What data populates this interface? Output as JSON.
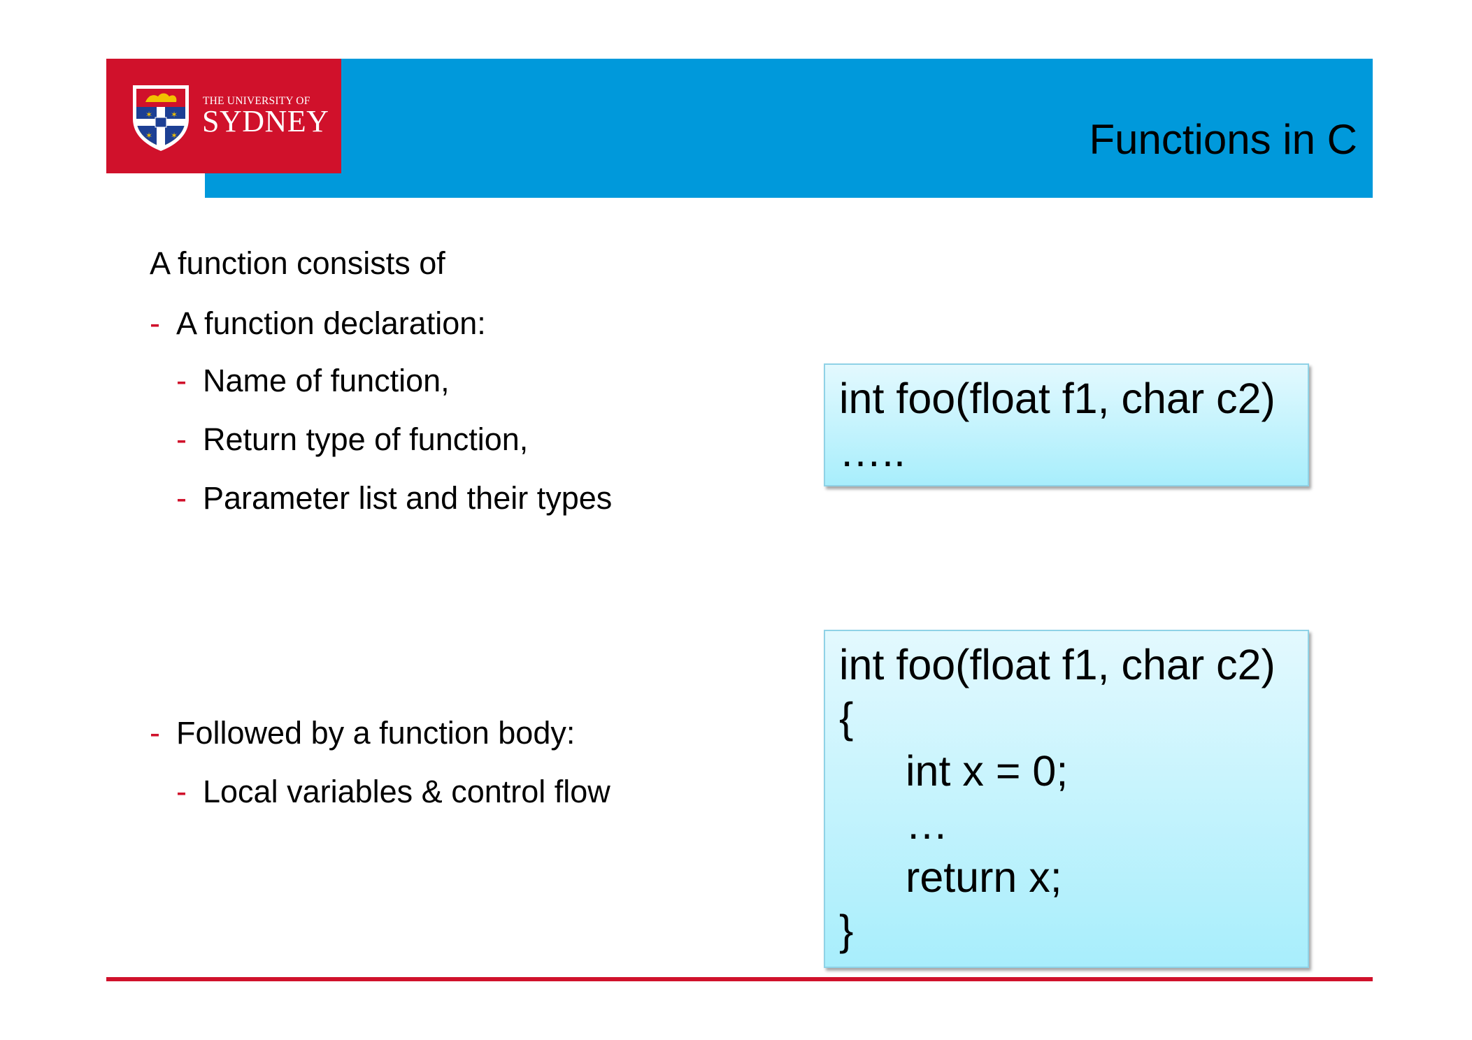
{
  "logo": {
    "line1": "THE UNIVERSITY OF",
    "line2": "SYDNEY"
  },
  "slide": {
    "title": "Functions in C"
  },
  "bullets": {
    "intro": "A function consists of",
    "dash": "-",
    "declaration": "A function declaration:",
    "name": "Name of function,",
    "return_type": "Return type of function,",
    "params": "Parameter list and their types",
    "body": "Followed by a function body:",
    "locals": "Local variables & control flow"
  },
  "code_declaration": {
    "line1": "int foo(float f1, char c2)",
    "line2": "….."
  },
  "code_body": {
    "line1": "int foo(float f1, char c2)",
    "line2": "{",
    "line3": "int x = 0;",
    "line4": "…",
    "line5": "return x;",
    "line6": "}"
  },
  "colors": {
    "header_blue": "#0099db",
    "brand_red": "#d0112b",
    "code_box_top": "#e3f9fe",
    "code_box_bottom": "#a8eefc"
  }
}
